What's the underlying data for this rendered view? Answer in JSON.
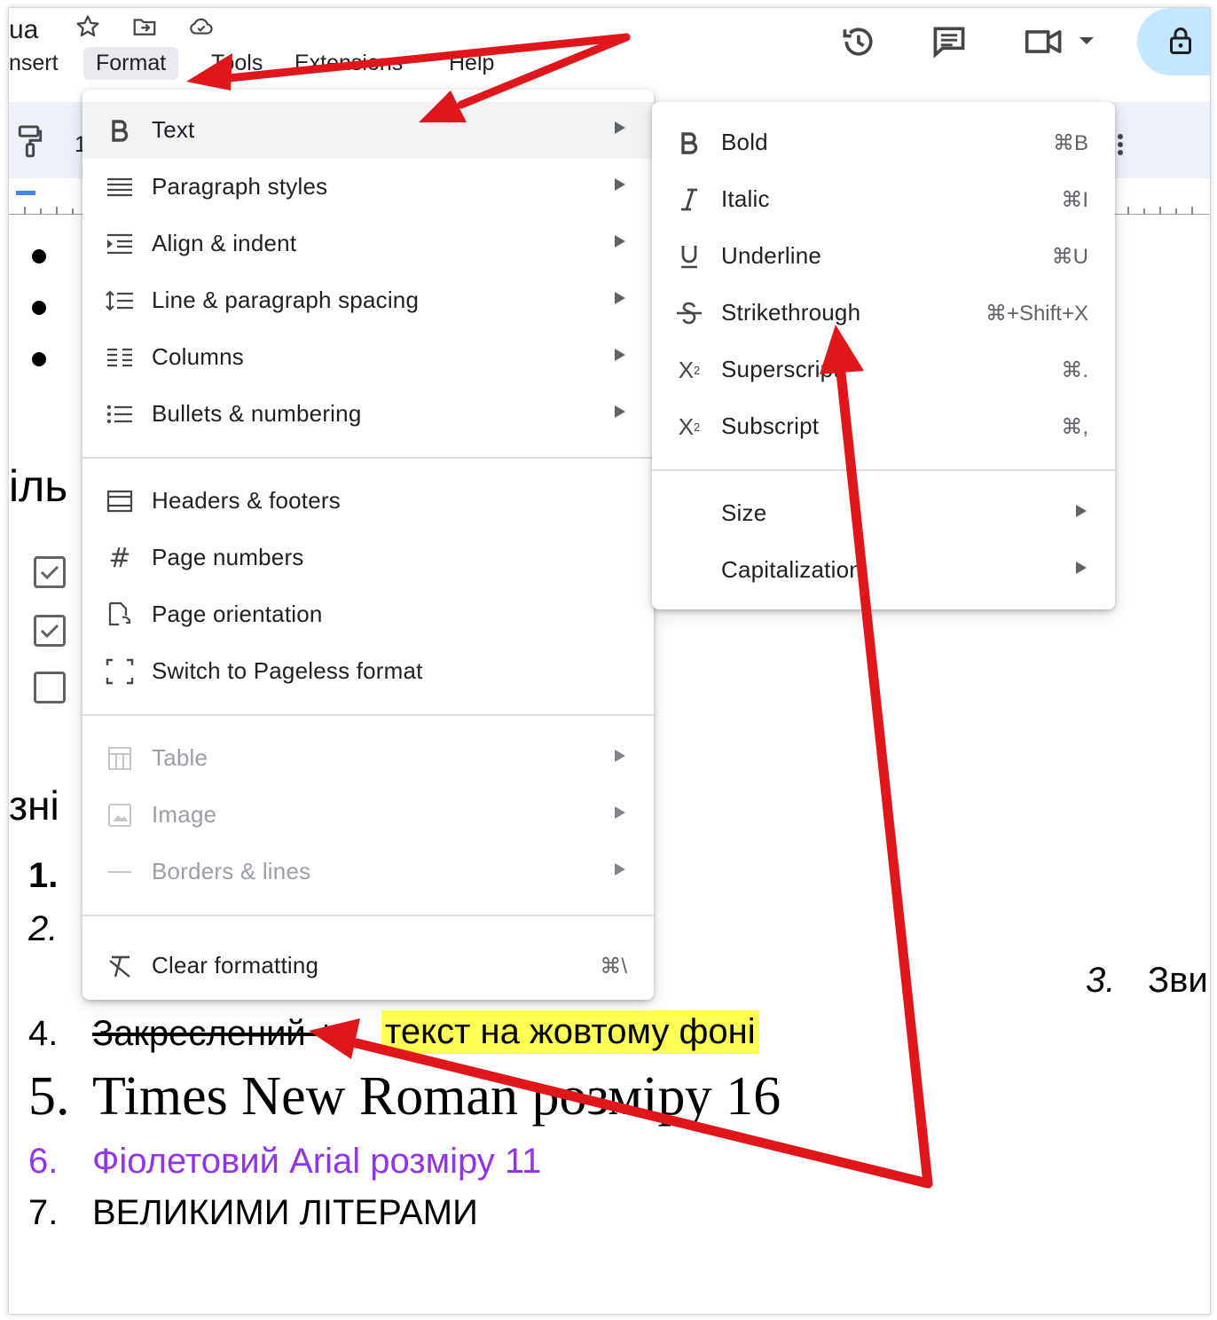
{
  "header": {
    "title_fragment": "ua",
    "menubar": [
      "nsert",
      "Format",
      "Tools",
      "Extensions",
      "Help"
    ],
    "toolbar_fragment": "1"
  },
  "format_menu": {
    "groups": [
      [
        {
          "icon": "bold-icon",
          "label": "Text",
          "submenu": true,
          "highlighted": true
        },
        {
          "icon": "paragraph-styles-icon",
          "label": "Paragraph styles",
          "submenu": true
        },
        {
          "icon": "align-indent-icon",
          "label": "Align & indent",
          "submenu": true
        },
        {
          "icon": "line-spacing-icon",
          "label": "Line & paragraph spacing",
          "submenu": true
        },
        {
          "icon": "columns-icon",
          "label": "Columns",
          "submenu": true
        },
        {
          "icon": "bulleted-list-icon",
          "label": "Bullets & numbering",
          "submenu": true
        }
      ],
      [
        {
          "icon": "header-footer-icon",
          "label": "Headers & footers"
        },
        {
          "icon": "hash-icon",
          "label": "Page numbers"
        },
        {
          "icon": "page-orientation-icon",
          "label": "Page orientation"
        },
        {
          "icon": "pageless-icon",
          "label": "Switch to Pageless format"
        }
      ],
      [
        {
          "icon": "table-icon",
          "label": "Table",
          "submenu": true,
          "disabled": true
        },
        {
          "icon": "image-icon",
          "label": "Image",
          "submenu": true,
          "disabled": true
        },
        {
          "icon": "borders-lines-icon",
          "label": "Borders & lines",
          "submenu": true,
          "disabled": true
        }
      ],
      [
        {
          "icon": "clear-formatting-icon",
          "label": "Clear formatting",
          "shortcut": "⌘\\"
        }
      ]
    ]
  },
  "text_submenu": {
    "items": [
      {
        "icon": "bold-icon",
        "label": "Bold",
        "shortcut": "⌘B"
      },
      {
        "icon": "italic-icon",
        "label": "Italic",
        "shortcut": "⌘I"
      },
      {
        "icon": "underline-icon",
        "label": "Underline",
        "shortcut": "⌘U"
      },
      {
        "icon": "strikethrough-icon",
        "label": "Strikethrough",
        "shortcut": "⌘+Shift+X"
      },
      {
        "icon": "superscript-icon",
        "label": "Superscript",
        "shortcut": "⌘."
      },
      {
        "icon": "subscript-icon",
        "label": "Subscript",
        "shortcut": "⌘,"
      }
    ],
    "more": [
      {
        "label": "Size",
        "submenu": true
      },
      {
        "label": "Capitalization",
        "submenu": true
      }
    ]
  },
  "document": {
    "heading_fragment_1": "іль",
    "heading_fragment_2": "зні",
    "num1": "1.",
    "num2": "2.",
    "item3_num": "3.",
    "item3_text": "Зви",
    "item4_num": "4.",
    "item4_strike": "Закреслений +",
    "item4_highlight": "текст на жовтому фоні",
    "item5_num": "5.",
    "item5_text": "Times New Roman розміру 16",
    "item6_num": "6.",
    "item6_text": "Фіолетовий Arial розміру 11",
    "item7_num": "7.",
    "item7_text": "ВЕЛИКИМИ ЛІТЕРАМИ"
  },
  "colors": {
    "annotation_arrow": "#e0161b",
    "highlight": "#ffff54",
    "purple_text": "#9333ea",
    "menu_highlight": "#f1f3f4",
    "lock_button": "#c2e7ff"
  }
}
